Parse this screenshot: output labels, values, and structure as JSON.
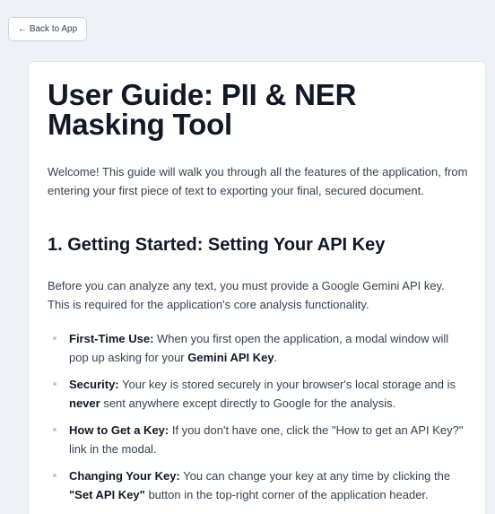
{
  "back_button": {
    "arrow": "←",
    "label": "Back to App"
  },
  "guide": {
    "title": "User Guide: PII & NER Masking Tool",
    "intro": "Welcome! This guide will walk you through all the features of the application, from entering your first piece of text to exporting your final, secured document.",
    "section1": {
      "heading": "1. Getting Started: Setting Your API Key",
      "paragraph": "Before you can analyze any text, you must provide a Google Gemini API key. This is required for the application's core analysis functionality.",
      "items": [
        {
          "label": "First-Time Use:",
          "text_before": " When you first open the application, a modal window will pop up asking for your ",
          "bold": "Gemini API Key",
          "text_after": "."
        },
        {
          "label": "Security:",
          "text_before": " Your key is stored securely in your browser's local storage and is ",
          "bold": "never",
          "text_after": " sent anywhere except directly to Google for the analysis."
        },
        {
          "label": "How to Get a Key:",
          "text_before": " If you don't have one, click the \"How to get an API Key?\" link in the modal.",
          "bold": "",
          "text_after": ""
        },
        {
          "label": "Changing Your Key:",
          "text_before": " You can change your key at any time by clicking the ",
          "bold": "\"Set API Key\"",
          "text_after": " button in the top-right corner of the application header."
        }
      ]
    }
  }
}
